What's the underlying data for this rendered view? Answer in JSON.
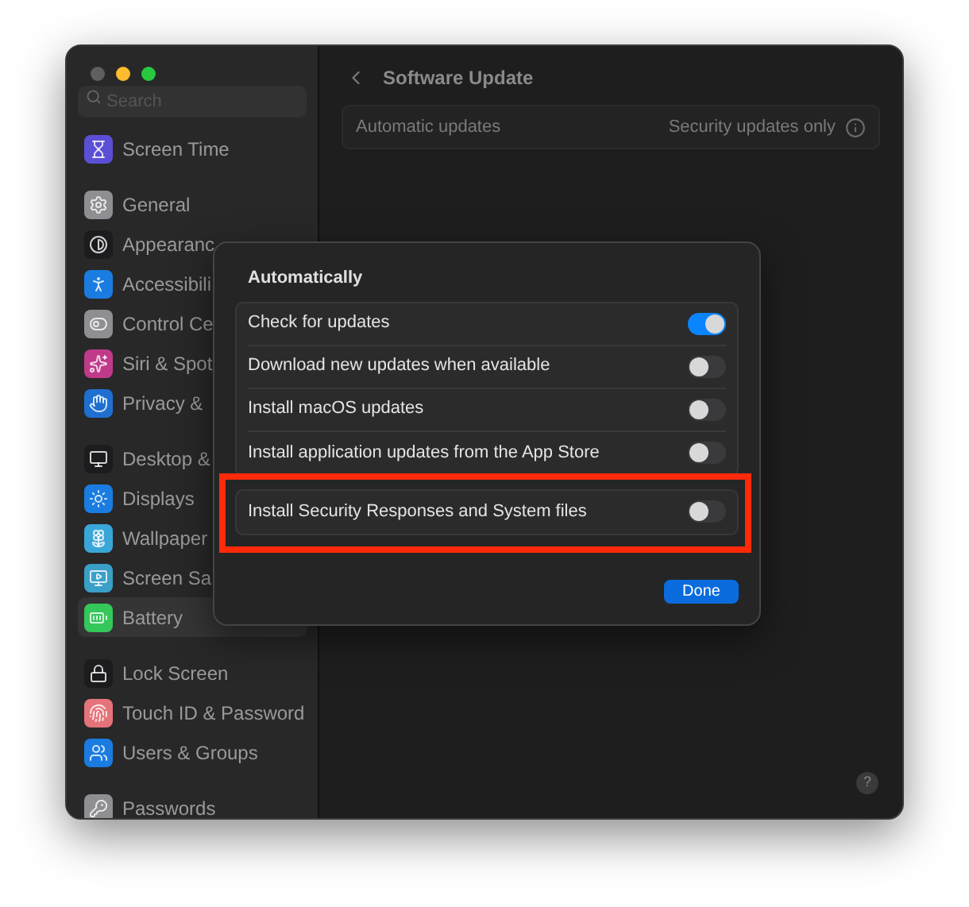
{
  "sidebar": {
    "search": {
      "placeholder": "Search"
    },
    "groups": [
      [
        {
          "label": "Screen Time",
          "color": "#5b4fd6",
          "selected": false
        }
      ],
      [
        {
          "label": "General",
          "color": "#8e8e93",
          "selected": false
        },
        {
          "label": "Appearanc",
          "color": "#1c1c1e",
          "selected": false
        },
        {
          "label": "Accessibili",
          "color": "#1a7ce0",
          "selected": false
        },
        {
          "label": "Control Ce",
          "color": "#8e8e93",
          "selected": false
        },
        {
          "label": "Siri & Spot",
          "color": "#c03a8a",
          "selected": false
        },
        {
          "label": "Privacy &",
          "color": "#1f6fd1",
          "selected": false
        }
      ],
      [
        {
          "label": "Desktop &",
          "color": "#1c1c1e",
          "selected": false
        },
        {
          "label": "Displays",
          "color": "#1a7ce0",
          "selected": false
        },
        {
          "label": "Wallpaper",
          "color": "#3aa6d8",
          "selected": false
        },
        {
          "label": "Screen Sa",
          "color": "#3aa0c8",
          "selected": false
        },
        {
          "label": "Battery",
          "color": "#34c759",
          "selected": true
        }
      ],
      [
        {
          "label": "Lock Screen",
          "color": "#1c1c1e",
          "selected": false
        },
        {
          "label": "Touch ID & Password",
          "color": "#e5737a",
          "selected": false
        },
        {
          "label": "Users & Groups",
          "color": "#1a7ce0",
          "selected": false
        }
      ],
      [
        {
          "label": "Passwords",
          "color": "#8e8e93",
          "selected": false
        }
      ]
    ]
  },
  "header": {
    "title": "Software Update"
  },
  "settings": [
    {
      "label": "Automatic updates",
      "value": "Security updates only"
    }
  ],
  "sheet": {
    "title": "Automatically",
    "groups": [
      [
        {
          "label": "Check for updates",
          "on": true,
          "highlighted": false
        },
        {
          "label": "Download new updates when available",
          "on": false,
          "highlighted": false
        },
        {
          "label": "Install macOS updates",
          "on": false,
          "highlighted": false
        },
        {
          "label": "Install application updates from the App Store",
          "on": false,
          "highlighted": false
        }
      ],
      [
        {
          "label": "Install Security Responses and System files",
          "on": false,
          "highlighted": true
        }
      ]
    ],
    "buttons": [
      "Done"
    ]
  },
  "help": "?"
}
